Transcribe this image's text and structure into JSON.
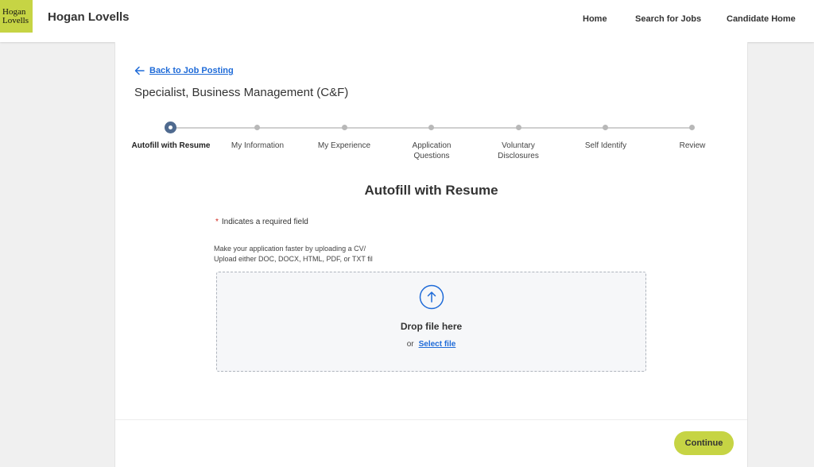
{
  "header": {
    "logo_line1": "Hogan",
    "logo_line2": "Lovells",
    "brand": "Hogan Lovells",
    "nav": [
      "Home",
      "Search for Jobs",
      "Candidate Home"
    ]
  },
  "job": {
    "back_label": "Back to Job Posting",
    "title": "Specialist, Business Management (C&F)"
  },
  "steps": [
    {
      "label": "Autofill with Resume",
      "active": true
    },
    {
      "label": "My Information",
      "active": false
    },
    {
      "label": "My Experience",
      "active": false
    },
    {
      "label": "Application Questions",
      "active": false
    },
    {
      "label": "Voluntary Disclosures",
      "active": false
    },
    {
      "label": "Self Identify",
      "active": false
    },
    {
      "label": "Review",
      "active": false
    }
  ],
  "section": {
    "title": "Autofill with Resume",
    "required_star": "*",
    "required_text": "Indicates a required field",
    "intro_line1": "Make your application faster by uploading a CV/",
    "intro_line2": "Upload either DOC, DOCX, HTML, PDF, or TXT file"
  },
  "dropzone": {
    "drop_text": "Drop file here",
    "or_text": "or",
    "select_label": "Select file"
  },
  "footer": {
    "continue_label": "Continue"
  },
  "colors": {
    "brand_green": "#c6d444",
    "link_blue": "#1f6bd8",
    "active_step": "#4f6a8f",
    "required_red": "#d0271d"
  }
}
